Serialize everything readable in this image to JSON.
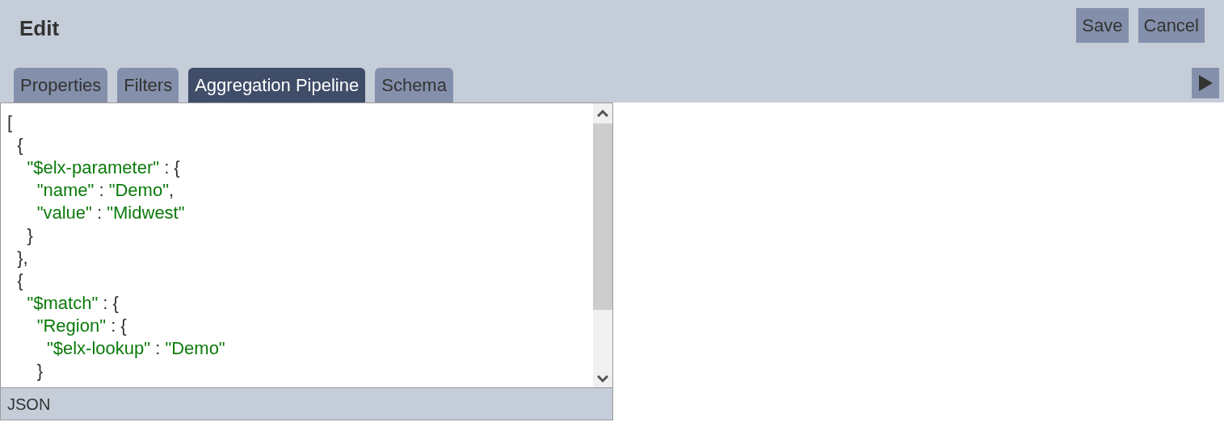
{
  "header": {
    "title": "Edit",
    "buttons": [
      "Save",
      "Cancel"
    ]
  },
  "tabs": [
    {
      "label": "Properties",
      "selected": false
    },
    {
      "label": "Filters",
      "selected": false
    },
    {
      "label": "Aggregation Pipeline",
      "selected": true
    },
    {
      "label": "Schema",
      "selected": false
    }
  ],
  "editor": {
    "lines": [
      [
        {
          "kind": "punct",
          "text": "["
        }
      ],
      [
        {
          "kind": "punct",
          "text": "  {"
        }
      ],
      [
        {
          "kind": "string",
          "text": "    \"$elx-parameter\""
        },
        {
          "kind": "punct",
          "text": " : {"
        }
      ],
      [
        {
          "kind": "string",
          "text": "      \"name\""
        },
        {
          "kind": "punct",
          "text": " : "
        },
        {
          "kind": "string",
          "text": "\"Demo\""
        },
        {
          "kind": "punct",
          "text": ","
        }
      ],
      [
        {
          "kind": "string",
          "text": "      \"value\""
        },
        {
          "kind": "punct",
          "text": " : "
        },
        {
          "kind": "string",
          "text": "\"Midwest\""
        }
      ],
      [
        {
          "kind": "punct",
          "text": "    }"
        }
      ],
      [
        {
          "kind": "punct",
          "text": "  },"
        }
      ],
      [
        {
          "kind": "punct",
          "text": "  {"
        }
      ],
      [
        {
          "kind": "string",
          "text": "    \"$match\""
        },
        {
          "kind": "punct",
          "text": " : {"
        }
      ],
      [
        {
          "kind": "string",
          "text": "      \"Region\""
        },
        {
          "kind": "punct",
          "text": " : {"
        }
      ],
      [
        {
          "kind": "string",
          "text": "        \"$elx-lookup\""
        },
        {
          "kind": "punct",
          "text": " : "
        },
        {
          "kind": "string",
          "text": "\"Demo\""
        }
      ],
      [
        {
          "kind": "punct",
          "text": "      }"
        }
      ]
    ],
    "mode": "JSON"
  }
}
